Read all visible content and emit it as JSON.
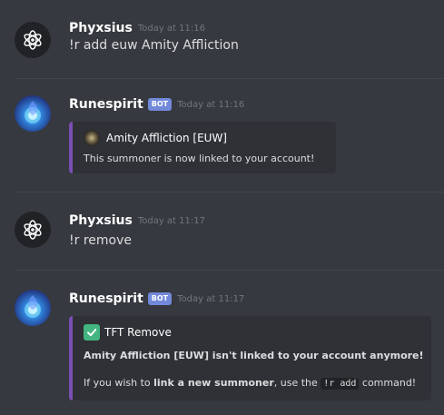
{
  "messages": [
    {
      "username": "Phyxsius",
      "timestamp": "Today at 11:16",
      "content": "!r add euw Amity Affliction"
    },
    {
      "username": "Runespirit",
      "bot_tag": "BOT",
      "timestamp": "Today at 11:16",
      "embed": {
        "author": "Amity Affliction [EUW]",
        "description": "This summoner is now linked to your account!"
      }
    },
    {
      "username": "Phyxsius",
      "timestamp": "Today at 11:17",
      "content": "!r remove"
    },
    {
      "username": "Runespirit",
      "bot_tag": "BOT",
      "timestamp": "Today at 11:17",
      "embed": {
        "title": "TFT Remove",
        "bold_line": "Amity Affliction [EUW] isn't linked to your account anymore!",
        "hint_prefix": "If you wish to ",
        "hint_bold": "link a new summoner",
        "hint_middle": ", use the ",
        "hint_code": "!r add",
        "hint_suffix": " command!"
      }
    }
  ],
  "colors": {
    "background": "#36393f",
    "embed_background": "#2f3136",
    "embed_border": "#7a4fb3",
    "bot_tag": "#7289da",
    "success": "#43b581"
  },
  "icons": {
    "user_avatar": "atom-icon",
    "bot_avatar": "orb-icon",
    "embed_author_icon": "summoner-icon",
    "title_icon": "check-icon"
  }
}
